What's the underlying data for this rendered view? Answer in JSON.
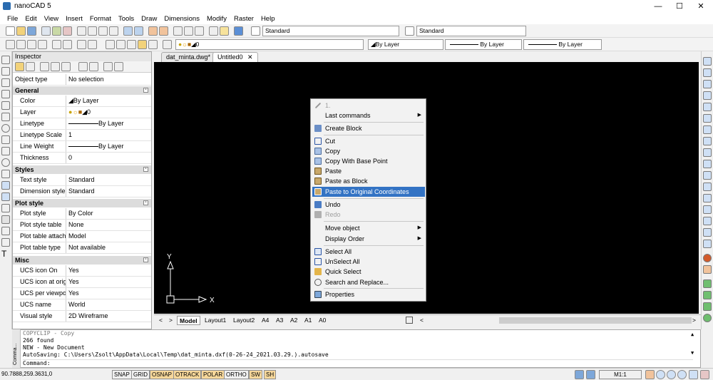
{
  "window": {
    "title": "nanoCAD 5",
    "min": "—",
    "max": "☐",
    "close": "✕"
  },
  "menu": [
    "File",
    "Edit",
    "View",
    "Insert",
    "Format",
    "Tools",
    "Draw",
    "Dimensions",
    "Modify",
    "Raster",
    "Help"
  ],
  "toolbar1": {
    "text_style": "Standard",
    "dim_style": "Standard"
  },
  "toolbar2": {
    "layer_value": "0",
    "color_value": "By Layer",
    "linetype_value": "By Layer",
    "lineweight_value": "By Layer"
  },
  "inspector": {
    "title": "Inspector",
    "object_type_label": "Object type",
    "object_type_value": "No selection",
    "categories": {
      "general": "General",
      "styles": "Styles",
      "plot_style": "Plot style",
      "misc": "Misc"
    },
    "general": [
      {
        "k": "Color",
        "v": "By Layer"
      },
      {
        "k": "Layer",
        "v": "0"
      },
      {
        "k": "Linetype",
        "v": "By Layer"
      },
      {
        "k": "Linetype Scale",
        "v": "1"
      },
      {
        "k": "Line Weight",
        "v": "By Layer"
      },
      {
        "k": "Thickness",
        "v": "0"
      }
    ],
    "styles": [
      {
        "k": "Text style",
        "v": "Standard"
      },
      {
        "k": "Dimension style",
        "v": "Standard"
      }
    ],
    "plot_style": [
      {
        "k": "Plot style",
        "v": "By Color"
      },
      {
        "k": "Plot style table",
        "v": "None"
      },
      {
        "k": "Plot table attach...",
        "v": "Model"
      },
      {
        "k": "Plot table type",
        "v": "Not available"
      }
    ],
    "misc": [
      {
        "k": "UCS icon On",
        "v": "Yes"
      },
      {
        "k": "UCS icon at origin",
        "v": "Yes"
      },
      {
        "k": "UCS per viewport",
        "v": "Yes"
      },
      {
        "k": "UCS name",
        "v": "World"
      },
      {
        "k": "Visual style",
        "v": "2D Wireframe"
      }
    ]
  },
  "doc_tabs": [
    {
      "label": "dat_minta.dwg*",
      "active": false
    },
    {
      "label": "Untitled0",
      "active": true,
      "close": "✕"
    }
  ],
  "ucs": {
    "x": "X",
    "y": "Y"
  },
  "layout_tabs": [
    "Model",
    "Layout1",
    "Layout2",
    "A4",
    "A3",
    "A2",
    "A1",
    "A0"
  ],
  "context_menu": {
    "items": [
      {
        "label": "1.",
        "icon": "arrow-icon",
        "disabled": true
      },
      {
        "label": "Last commands",
        "submenu": true
      },
      {
        "label": "Create Block",
        "icon": "block-icon"
      },
      {
        "label": "Cut",
        "icon": "scissors-icon"
      },
      {
        "label": "Copy",
        "icon": "copy-icon"
      },
      {
        "label": "Copy With Base Point",
        "icon": "copy-base-icon"
      },
      {
        "label": "Paste",
        "icon": "paste-icon"
      },
      {
        "label": "Paste as Block",
        "icon": "paste-block-icon"
      },
      {
        "label": "Paste to Original Coordinates",
        "icon": "paste-orig-icon",
        "highlighted": true
      },
      {
        "label": "Undo",
        "icon": "undo-icon"
      },
      {
        "label": "Redo",
        "icon": "redo-icon",
        "disabled": true
      },
      {
        "label": "Move object",
        "submenu": true
      },
      {
        "label": "Display Order",
        "submenu": true
      },
      {
        "label": "Select All",
        "icon": "select-all-icon"
      },
      {
        "label": "UnSelect All",
        "icon": "unselect-all-icon"
      },
      {
        "label": "Quick Select",
        "icon": "quick-select-icon"
      },
      {
        "label": "Search and Replace...",
        "icon": "search-replace-icon"
      },
      {
        "label": "Properties",
        "icon": "properties-icon"
      }
    ],
    "submenu_arrow": "▶"
  },
  "command_area": {
    "lines": [
      "COPYCLIP - Copy",
      "266 found",
      "NEW - New Document",
      "AutoSaving: C:\\Users\\Zsolt\\AppData\\Local\\Temp\\dat_minta.dxf(0-26-24_2021.03.29.).autosave",
      "Command:"
    ],
    "side_label": "Comma..."
  },
  "status": {
    "coords": "90.7888,259.3631,0",
    "buttons": [
      {
        "label": "SNAP",
        "on": false
      },
      {
        "label": "GRID",
        "on": false
      },
      {
        "label": "OSNAP",
        "on": true
      },
      {
        "label": "OTRACK",
        "on": true
      },
      {
        "label": "POLAR",
        "on": true
      },
      {
        "label": "ORTHO",
        "on": false
      },
      {
        "label": "SW",
        "on": true
      },
      {
        "label": "SH",
        "on": true
      }
    ],
    "scale": "M1:1"
  },
  "colors": {
    "highlight": "#3373c4",
    "canvas": "#000000",
    "toggle_on": "#f6d79a"
  }
}
